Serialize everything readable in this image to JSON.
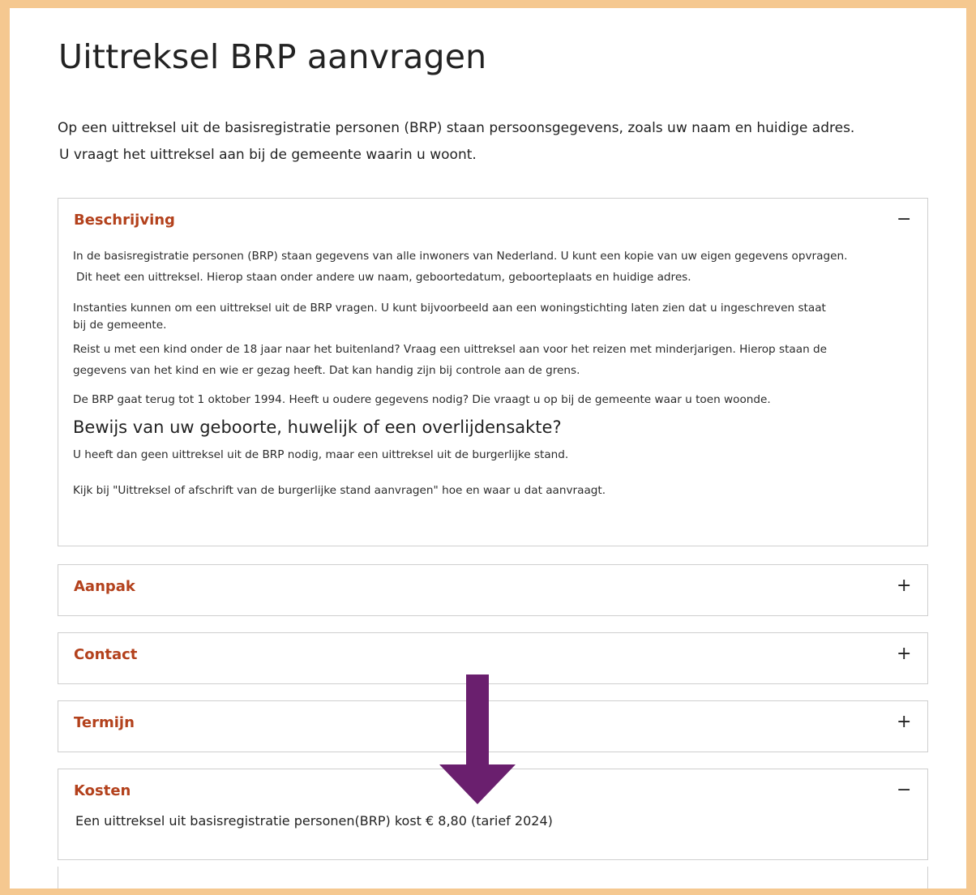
{
  "page": {
    "title": "Uittreksel BRP aanvragen",
    "intro_line1": "Op een uittreksel uit de basisregistratie personen (BRP) staan persoonsgegevens, zoals uw naam en huidige adres.",
    "intro_line2": "U vraagt het uittreksel aan bij de gemeente waarin u woont."
  },
  "accordion": {
    "beschrijving": {
      "title": "Beschrijving",
      "toggle": "−",
      "p1_line1": "In de basisregistratie personen (BRP) staan gegevens van alle inwoners van Nederland. U kunt een kopie van uw eigen gegevens opvragen.",
      "p1_line2": "Dit heet een  uittreksel. Hierop staan onder andere uw naam, geboortedatum, geboorteplaats en huidige adres.",
      "p2_line1": "Instanties kunnen om een uittreksel uit de BRP vragen. U kunt bijvoorbeeld aan een woningstichting laten zien dat u ingeschreven staat",
      "p2_line2": "bij de gemeente.",
      "p3_line1": "Reist u met een kind onder de 18 jaar naar het buitenland? Vraag een uittreksel aan voor het reizen met minderjarigen. Hierop staan de",
      "p3_line2": "gegevens van het  kind en wie er gezag heeft. Dat kan handig zijn bij controle aan de grens.",
      "p4": "De BRP gaat terug tot 1 oktober 1994. Heeft u oudere gegevens nodig? Die vraagt u op bij de gemeente waar u toen woonde.",
      "subheading": "Bewijs van uw geboorte, huwelijk of een overlijdensakte?",
      "p5": "U heeft dan geen uittreksel uit de BRP nodig, maar een uittreksel uit de burgerlijke stand.",
      "p6": "Kijk bij \"Uittreksel of afschrift van de burgerlijke stand aanvragen\" hoe en waar u dat aanvraagt."
    },
    "aanpak": {
      "title": "Aanpak",
      "toggle": "+"
    },
    "contact": {
      "title": "Contact",
      "toggle": "+"
    },
    "termijn": {
      "title": "Termijn",
      "toggle": "+"
    },
    "kosten": {
      "title": "Kosten",
      "toggle": "−",
      "text": "Een uittreksel uit basisregistratie personen(BRP) kost € 8,80 (tarief 2024)"
    }
  },
  "colors": {
    "frame": "#f5c890",
    "heading_accent": "#b3411c",
    "arrow": "#6a1f6e",
    "border": "#cfcfcf"
  }
}
